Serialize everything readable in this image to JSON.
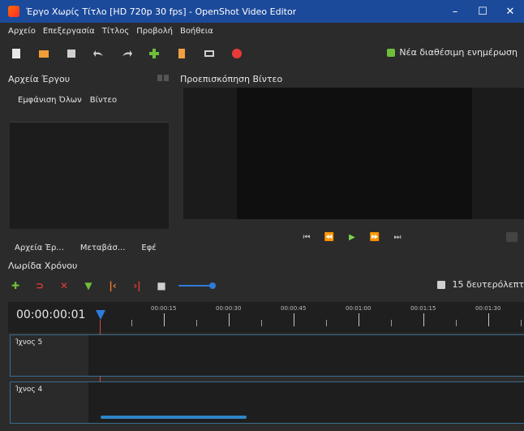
{
  "window": {
    "title": "Έργο Χωρίς Τίτλο [HD 720p 30 fps] - OpenShot Video Editor",
    "controls": {
      "minimize": "–",
      "maximize": "☐",
      "close": "✕"
    }
  },
  "menu": [
    "Αρχείο",
    "Επεξεργασία",
    "Τίτλος",
    "Προβολή",
    "Βοήθεια"
  ],
  "toolbar": {
    "buttons": [
      {
        "name": "new-project-icon",
        "color": "#e8e8e8"
      },
      {
        "name": "open-project-icon",
        "color": "#f29d38"
      },
      {
        "name": "save-project-icon",
        "color": "#cfcfcf"
      },
      {
        "name": "undo-icon",
        "color": "#cfcfcf"
      },
      {
        "name": "redo-icon",
        "color": "#cfcfcf"
      },
      {
        "name": "import-files-icon",
        "color": "#6fbe3a"
      },
      {
        "name": "profile-icon",
        "color": "#f0a040"
      },
      {
        "name": "fullscreen-icon",
        "color": "#cfcfcf"
      },
      {
        "name": "export-video-icon",
        "color": "#e83a3a"
      }
    ],
    "update_notice": "Νέα διαθέσιμη ενημέρωση"
  },
  "project_files": {
    "header": "Αρχεία Έργου",
    "filters": [
      "Εμφάνιση Όλων",
      "Βίντεο"
    ],
    "tabs": [
      "Αρχεία Έρ...",
      "Μεταβάσ...",
      "Εφέ"
    ]
  },
  "preview": {
    "header": "Προεπισκόπηση Βίντεο"
  },
  "timeline": {
    "header": "Λωρίδα Χρόνου",
    "zoom_label": "15 δευτερόλεπτ",
    "timecode": "00:00:00:01",
    "ticks": [
      "00:00:15",
      "00:00:30",
      "00:00:45",
      "00:01:00",
      "00:01:15",
      "00:01:30"
    ],
    "tracks": [
      "Ίχνος 5",
      "Ίχνος 4"
    ]
  }
}
